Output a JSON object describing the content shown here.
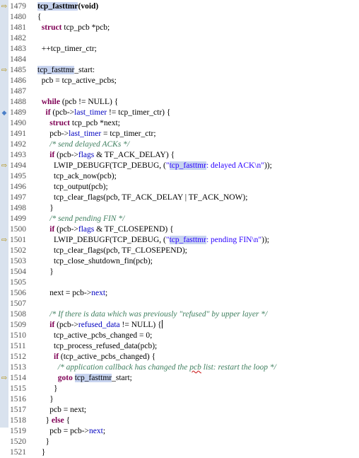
{
  "editor": {
    "lines": [
      {
        "num": "1479",
        "marker": "arrow",
        "tokens": [
          [
            "tcp_fasttmr",
            "hlb"
          ],
          [
            "(void)",
            "b"
          ]
        ]
      },
      {
        "num": "1480",
        "marker": "",
        "tokens": [
          [
            "{",
            ""
          ]
        ]
      },
      {
        "num": "1481",
        "marker": "",
        "tokens": [
          [
            "  ",
            ""
          ],
          [
            "struct",
            "kw"
          ],
          [
            " tcp_pcb *pcb;",
            ""
          ]
        ]
      },
      {
        "num": "1482",
        "marker": "",
        "tokens": []
      },
      {
        "num": "1483",
        "marker": "",
        "tokens": [
          [
            "  ++tcp_timer_ctr;",
            ""
          ]
        ]
      },
      {
        "num": "1484",
        "marker": "",
        "tokens": []
      },
      {
        "num": "1485",
        "marker": "arrow",
        "tokens": [
          [
            "tcp_fasttmr",
            "hl"
          ],
          [
            "_start:",
            ""
          ]
        ]
      },
      {
        "num": "1486",
        "marker": "",
        "tokens": [
          [
            "  pcb = tcp_active_pcbs;",
            ""
          ]
        ]
      },
      {
        "num": "1487",
        "marker": "",
        "tokens": []
      },
      {
        "num": "1488",
        "marker": "",
        "tokens": [
          [
            "  ",
            ""
          ],
          [
            "while",
            "kw"
          ],
          [
            " (pcb != NULL) {",
            ""
          ]
        ]
      },
      {
        "num": "1489",
        "marker": "bp",
        "tokens": [
          [
            "    ",
            ""
          ],
          [
            "if",
            "kw"
          ],
          [
            " (pcb->",
            ""
          ],
          [
            "last_timer",
            "fld"
          ],
          [
            " != tcp_timer_ctr) {",
            ""
          ]
        ]
      },
      {
        "num": "1490",
        "marker": "",
        "tokens": [
          [
            "      ",
            ""
          ],
          [
            "struct",
            "kw"
          ],
          [
            " tcp_pcb *next;",
            ""
          ]
        ]
      },
      {
        "num": "1491",
        "marker": "",
        "tokens": [
          [
            "      pcb->",
            ""
          ],
          [
            "last_timer",
            "fld"
          ],
          [
            " = tcp_timer_ctr;",
            ""
          ]
        ]
      },
      {
        "num": "1492",
        "marker": "",
        "tokens": [
          [
            "      ",
            ""
          ],
          [
            "/* send delayed ACKs */",
            "cmt"
          ]
        ]
      },
      {
        "num": "1493",
        "marker": "",
        "tokens": [
          [
            "      ",
            ""
          ],
          [
            "if",
            "kw"
          ],
          [
            " (pcb->",
            ""
          ],
          [
            "flags",
            "fld"
          ],
          [
            " & TF_ACK_DELAY) {",
            ""
          ]
        ]
      },
      {
        "num": "1494",
        "marker": "arrow",
        "tokens": [
          [
            "        LWIP_DEBUGF(TCP_DEBUG, (",
            ""
          ],
          [
            "\"",
            "str"
          ],
          [
            "tcp_fasttmr",
            "hl str"
          ],
          [
            ": delayed ACK\\n\"",
            "str"
          ],
          [
            "));",
            ""
          ]
        ]
      },
      {
        "num": "1495",
        "marker": "",
        "tokens": [
          [
            "        tcp_ack_now(pcb);",
            ""
          ]
        ]
      },
      {
        "num": "1496",
        "marker": "",
        "tokens": [
          [
            "        tcp_output(pcb);",
            ""
          ]
        ]
      },
      {
        "num": "1497",
        "marker": "",
        "tokens": [
          [
            "        tcp_clear_flags(pcb, TF_ACK_DELAY | TF_ACK_NOW);",
            ""
          ]
        ]
      },
      {
        "num": "1498",
        "marker": "",
        "tokens": [
          [
            "      }",
            ""
          ]
        ]
      },
      {
        "num": "1499",
        "marker": "",
        "tokens": [
          [
            "      ",
            ""
          ],
          [
            "/* send pending FIN */",
            "cmt"
          ]
        ]
      },
      {
        "num": "1500",
        "marker": "",
        "tokens": [
          [
            "      ",
            ""
          ],
          [
            "if",
            "kw"
          ],
          [
            " (pcb->",
            ""
          ],
          [
            "flags",
            "fld"
          ],
          [
            " & TF_CLOSEPEND) {",
            ""
          ]
        ]
      },
      {
        "num": "1501",
        "marker": "arrow",
        "tokens": [
          [
            "        LWIP_DEBUGF(TCP_DEBUG, (",
            ""
          ],
          [
            "\"",
            "str"
          ],
          [
            "tcp_fasttmr",
            "hl str"
          ],
          [
            ": pending FIN\\n\"",
            "str"
          ],
          [
            "));",
            ""
          ]
        ]
      },
      {
        "num": "1502",
        "marker": "",
        "tokens": [
          [
            "        tcp_clear_flags(pcb, TF_CLOSEPEND);",
            ""
          ]
        ]
      },
      {
        "num": "1503",
        "marker": "",
        "tokens": [
          [
            "        tcp_close_shutdown_fin(pcb);",
            ""
          ]
        ]
      },
      {
        "num": "1504",
        "marker": "",
        "tokens": [
          [
            "      }",
            ""
          ]
        ]
      },
      {
        "num": "1505",
        "marker": "",
        "tokens": []
      },
      {
        "num": "1506",
        "marker": "",
        "tokens": [
          [
            "      next = pcb->",
            ""
          ],
          [
            "next",
            "fld"
          ],
          [
            ";",
            ""
          ]
        ]
      },
      {
        "num": "1507",
        "marker": "",
        "tokens": []
      },
      {
        "num": "1508",
        "marker": "",
        "tokens": [
          [
            "      ",
            ""
          ],
          [
            "/* If there is data which was previously \"refused\" by upper layer */",
            "cmt"
          ]
        ]
      },
      {
        "num": "1509",
        "marker": "",
        "tokens": [
          [
            "      ",
            ""
          ],
          [
            "if",
            "kw"
          ],
          [
            " (pcb->",
            ""
          ],
          [
            "refused_data",
            "fld"
          ],
          [
            " != NULL) {",
            ""
          ],
          [
            "",
            "caret"
          ]
        ]
      },
      {
        "num": "1510",
        "marker": "",
        "tokens": [
          [
            "        tcp_active_pcbs_changed = 0;",
            ""
          ]
        ]
      },
      {
        "num": "1511",
        "marker": "",
        "tokens": [
          [
            "        tcp_process_refused_data(pcb);",
            ""
          ]
        ]
      },
      {
        "num": "1512",
        "marker": "",
        "tokens": [
          [
            "        ",
            ""
          ],
          [
            "if",
            "kw"
          ],
          [
            " (tcp_active_pcbs_changed) {",
            ""
          ]
        ]
      },
      {
        "num": "1513",
        "marker": "",
        "tokens": [
          [
            "          ",
            ""
          ],
          [
            "/* application callback has changed the ",
            "cmt"
          ],
          [
            "pcb",
            "cmt spell"
          ],
          [
            " list: restart the loop */",
            "cmt"
          ]
        ]
      },
      {
        "num": "1514",
        "marker": "arrow",
        "tokens": [
          [
            "          ",
            ""
          ],
          [
            "goto",
            "kw"
          ],
          [
            " ",
            ""
          ],
          [
            "tcp_fasttmr",
            "hl"
          ],
          [
            "_start;",
            ""
          ]
        ]
      },
      {
        "num": "1515",
        "marker": "",
        "tokens": [
          [
            "        }",
            ""
          ]
        ]
      },
      {
        "num": "1516",
        "marker": "",
        "tokens": [
          [
            "      }",
            ""
          ]
        ]
      },
      {
        "num": "1517",
        "marker": "",
        "tokens": [
          [
            "      pcb = next;",
            ""
          ]
        ]
      },
      {
        "num": "1518",
        "marker": "",
        "tokens": [
          [
            "    } ",
            ""
          ],
          [
            "else",
            "kw"
          ],
          [
            " {",
            ""
          ]
        ]
      },
      {
        "num": "1519",
        "marker": "",
        "tokens": [
          [
            "      pcb = pcb->",
            ""
          ],
          [
            "next",
            "fld"
          ],
          [
            ";",
            ""
          ]
        ]
      },
      {
        "num": "1520",
        "marker": "",
        "tokens": [
          [
            "    }",
            ""
          ]
        ]
      },
      {
        "num": "1521",
        "marker": "",
        "tokens": [
          [
            "  }",
            ""
          ]
        ]
      }
    ]
  },
  "icons": {
    "arrow": "⇨",
    "bp": "◆"
  }
}
